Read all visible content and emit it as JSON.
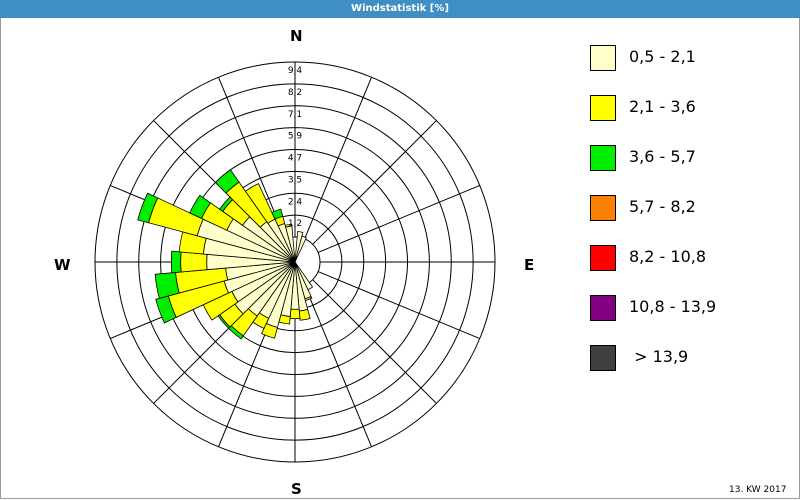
{
  "window": {
    "title": "Windstatistik [%]"
  },
  "compass": {
    "n": "N",
    "e": "E",
    "s": "S",
    "w": "W"
  },
  "footnote": "13. KW 2017",
  "chart_data": {
    "type": "wind_rose",
    "title": "Windstatistik [%]",
    "unit": "%",
    "radial_ticks": [
      "1,2",
      "2,4",
      "3,5",
      "4,7",
      "5,9",
      "7,1",
      "8,2",
      "9,4"
    ],
    "rmax": 9.4,
    "sector_width_deg": 10,
    "legend": [
      {
        "label": "0,5 - 2,1",
        "color": "#ffffcc"
      },
      {
        "label": "2,1 - 3,6",
        "color": "#ffff00"
      },
      {
        "label": "3,6 - 5,7",
        "color": "#00ee00"
      },
      {
        "label": "5,7 - 8,2",
        "color": "#ff8000"
      },
      {
        "label": "8,2 - 10,8",
        "color": "#ff0000"
      },
      {
        "label": "10,8 - 13,9",
        "color": "#800080"
      },
      {
        "label": " > 13,9",
        "color": "#404040"
      }
    ],
    "sectors": [
      {
        "dir": 10,
        "values": [
          0.3,
          0,
          0
        ]
      },
      {
        "dir": 20,
        "values": [
          0.1,
          0,
          0
        ]
      },
      {
        "dir": 150,
        "values": [
          0.3,
          0,
          0
        ]
      },
      {
        "dir": 160,
        "values": [
          0.7,
          0.1,
          0
        ]
      },
      {
        "dir": 170,
        "values": [
          1.3,
          0.5,
          0
        ]
      },
      {
        "dir": 180,
        "values": [
          1.2,
          0.5,
          0
        ]
      },
      {
        "dir": 190,
        "values": [
          1.6,
          0.4,
          0
        ]
      },
      {
        "dir": 200,
        "values": [
          2.3,
          0.6,
          0
        ]
      },
      {
        "dir": 210,
        "values": [
          2.0,
          0.6,
          0
        ]
      },
      {
        "dir": 220,
        "values": [
          2.2,
          1.3,
          0.2
        ]
      },
      {
        "dir": 230,
        "values": [
          2.6,
          1.0,
          0.1
        ]
      },
      {
        "dir": 240,
        "values": [
          2.4,
          1.7,
          0
        ]
      },
      {
        "dir": 250,
        "values": [
          2.6,
          3.1,
          0.7
        ]
      },
      {
        "dir": 260,
        "values": [
          2.4,
          2.7,
          1.1
        ]
      },
      {
        "dir": 270,
        "values": [
          3.4,
          1.4,
          0.5
        ]
      },
      {
        "dir": 280,
        "values": [
          3.6,
          1.3,
          0
        ]
      },
      {
        "dir": 290,
        "values": [
          4.1,
          2.7,
          0.6
        ]
      },
      {
        "dir": 300,
        "values": [
          2.7,
          1.5,
          0.7
        ]
      },
      {
        "dir": 310,
        "values": [
          2.1,
          1.3,
          0.2
        ]
      },
      {
        "dir": 320,
        "values": [
          1.3,
          2.6,
          0.8
        ]
      },
      {
        "dir": 330,
        "values": [
          1.2,
          2.1,
          0
        ]
      },
      {
        "dir": 340,
        "values": [
          0.8,
          0.4,
          0.4
        ]
      },
      {
        "dir": 350,
        "values": [
          0.6,
          0.1,
          0
        ]
      }
    ]
  }
}
